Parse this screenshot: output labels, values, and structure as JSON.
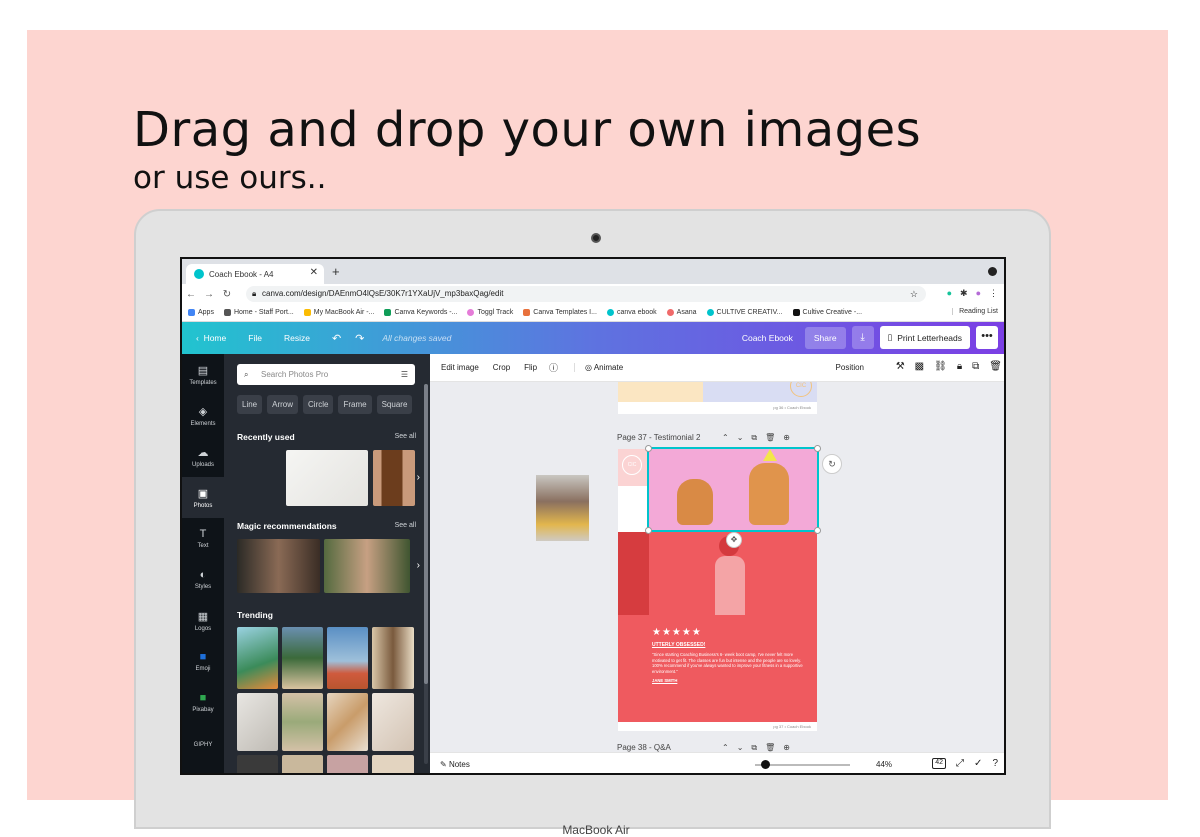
{
  "headline": "Drag and drop your own images",
  "subheadline": "or use ours..",
  "laptop_label": "MacBook Air",
  "browser": {
    "tab_title": "Coach Ebook - A4",
    "url": "canva.com/design/DAEnmO4lQsE/30K7r1YXaUjV_mp3baxQag/edit",
    "bookmarks": [
      "Apps",
      "Home - Staff Port...",
      "My MacBook Air -...",
      "Canva Keywords -...",
      "Toggl Track",
      "Canva Templates I...",
      "canva ebook",
      "Asana",
      "CULTIVE CREATIV...",
      "Cultive Creative -..."
    ],
    "reading_list": "Reading List"
  },
  "canva_header": {
    "home": "Home",
    "file": "File",
    "resize": "Resize",
    "saved": "All changes saved",
    "doc_title": "Coach Ebook",
    "share": "Share",
    "print": "Print Letterheads",
    "more": "•••"
  },
  "rail": [
    "Templates",
    "Elements",
    "Uploads",
    "Photos",
    "Text",
    "Styles",
    "Logos",
    "Emoji",
    "Pixabay",
    "GIPHY"
  ],
  "panel": {
    "search_placeholder": "Search Photos Pro",
    "chips": [
      "Line",
      "Arrow",
      "Circle",
      "Frame",
      "Square"
    ],
    "recently_used": "Recently used",
    "magic": "Magic recommendations",
    "trending": "Trending",
    "see_all": "See all"
  },
  "toolbar": {
    "edit_image": "Edit image",
    "crop": "Crop",
    "flip": "Flip",
    "animate": "Animate",
    "position": "Position"
  },
  "canvas": {
    "page37": "Page 37 - Testimonial 2",
    "page38": "Page 38 - Q&A",
    "stars": "★★★★★",
    "quote_title": "UTTERLY OBSESSED!",
    "quote_body": "\"Since starting Coaching Business's 6- week boot camp, I've never felt more motivated to get fit. The classes are fun but intense and the people are so lovely. 100% recommend if you've always wanted to improve your fitness in a supportive environment.\"",
    "quote_author": "JANE SMITH",
    "logo": "CIC",
    "page_footer": "pg 37  •  Coach Ebook",
    "page_footer_top": "pg 36  •  Coach Ebook"
  },
  "footer": {
    "notes": "Notes",
    "zoom": "44%",
    "page_count": "42"
  },
  "colors": {
    "poster_bg": "#fdd5d0",
    "canva_gradient_start": "#21c4cf",
    "canva_gradient_end": "#7b3fe4",
    "testimonial_red": "#ef5a5f",
    "dog_bg_pink": "#f3a9d7"
  }
}
